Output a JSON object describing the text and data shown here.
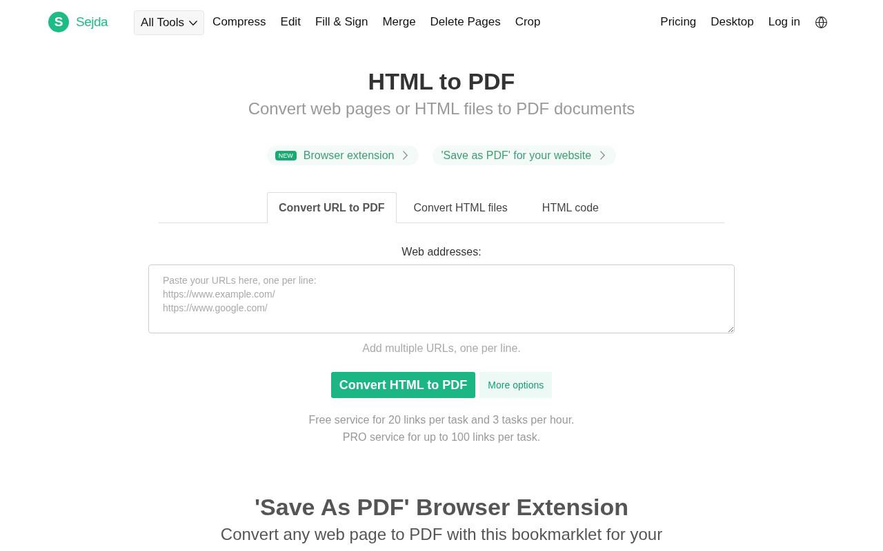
{
  "nav": {
    "logo": {
      "letter": "S",
      "name": "Sejda"
    },
    "menu_button": {
      "label": "All Tools"
    },
    "links": [
      "Compress",
      "Edit",
      "Fill & Sign",
      "Merge",
      "Delete Pages",
      "Crop"
    ],
    "right_links": [
      "Pricing",
      "Desktop",
      "Log in"
    ]
  },
  "hero": {
    "title": "HTML to PDF",
    "subtitle": "Convert web pages or HTML files to PDF documents"
  },
  "promo_links": [
    {
      "badge": "NEW",
      "label": "Browser extension"
    },
    {
      "label": "'Save as PDF' for your website"
    }
  ],
  "tabs": [
    {
      "label": "Convert URL to PDF",
      "selected": true
    },
    {
      "label": "Convert HTML files",
      "selected": false
    },
    {
      "label": "HTML code",
      "selected": false
    }
  ],
  "form": {
    "label": "Web addresses:",
    "placeholder": "Paste your URLs here, one per line:\nhttps://www.example.com/\nhttps://www.google.com/",
    "hint": "Add multiple URLs, one per line.",
    "primary_button": "Convert HTML to PDF",
    "secondary_button": "More options",
    "notes": [
      "Free service for 20 links per task and 3 tasks per hour.",
      "PRO service for up to 100 links per task."
    ]
  },
  "extension_section": {
    "title": "'Save As PDF' Browser Extension",
    "subtitle": "Convert any web page to PDF with this bookmarklet for your"
  }
}
